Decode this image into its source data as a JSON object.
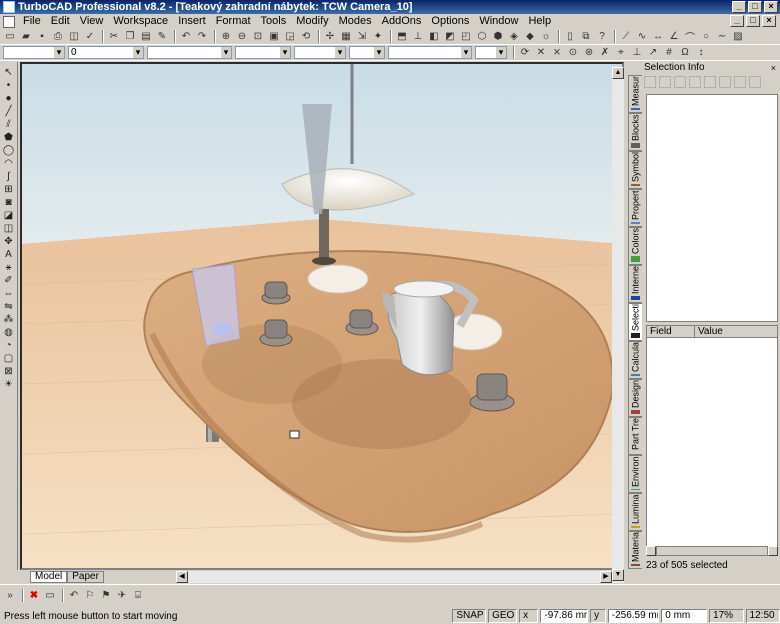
{
  "window": {
    "title": "TurboCAD Professional v8.2 - [Teakový zahradní nábytek: TCW Camera_10]"
  },
  "menu": [
    "File",
    "Edit",
    "View",
    "Workspace",
    "Insert",
    "Format",
    "Tools",
    "Modify",
    "Modes",
    "AddOns",
    "Options",
    "Window",
    "Help"
  ],
  "property_toolbar": {
    "layer_value": "",
    "line_width_value": "0",
    "color_value": "",
    "style_value": ""
  },
  "doc_tabs": [
    "Model",
    "Paper"
  ],
  "right_tabs": [
    "Measur",
    "Blocks",
    "Symbol",
    "Propert",
    "Colors",
    "Interne",
    "Selecti",
    "Calcula",
    "Design",
    "Part Tre",
    "Environ",
    "Lumina",
    "Materia"
  ],
  "selection_panel": {
    "title": "Selection Info",
    "col_field": "Field",
    "col_value": "Value",
    "count_text": "23 of 505 selected"
  },
  "status": {
    "message": "Press left mouse button to start moving",
    "snap": "SNAP",
    "geo": "GEO",
    "x": "-97.86 mm",
    "y": "-256.59 mm",
    "z": "0 mm",
    "zoom": "17%",
    "time": "12:50"
  },
  "icons": {
    "close": "close-icon",
    "minimize": "minimize-icon",
    "maximize": "maximize-icon"
  }
}
